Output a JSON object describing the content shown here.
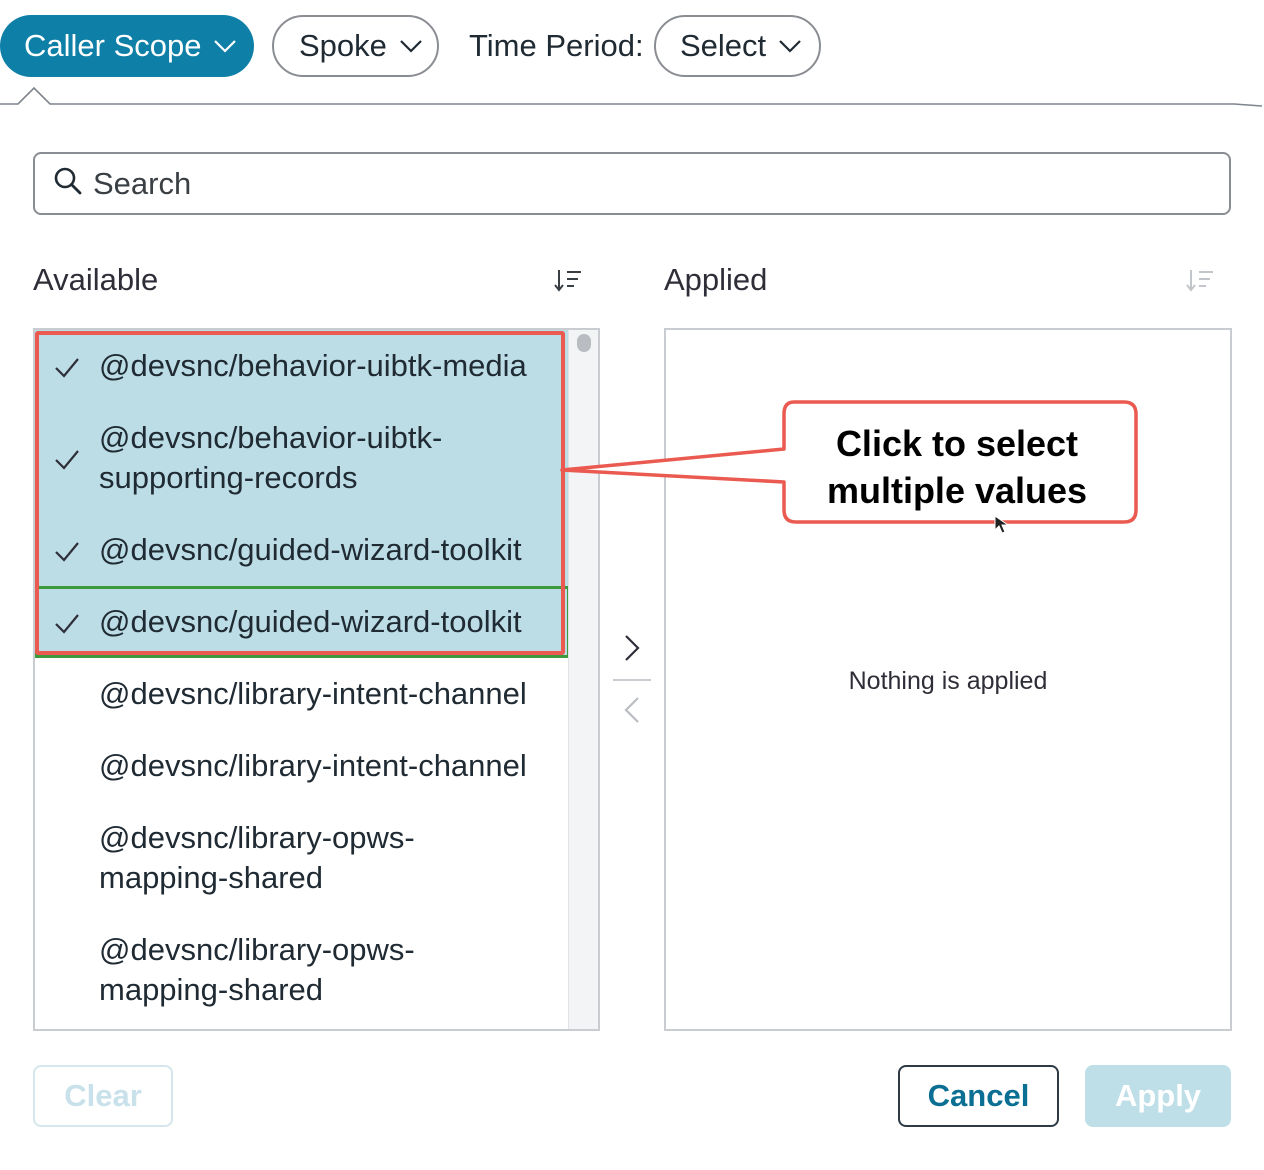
{
  "filters": {
    "caller_scope_label": "Caller Scope",
    "spoke_label": "Spoke",
    "time_period_label": "Time Period:",
    "time_period_select": "Select"
  },
  "search": {
    "placeholder": "Search"
  },
  "available": {
    "title": "Available",
    "items": [
      {
        "lines": [
          "@devsnc/behavior-uibtk-media"
        ],
        "selected": true
      },
      {
        "lines": [
          "@devsnc/behavior-uibtk-",
          "supporting-records"
        ],
        "selected": true
      },
      {
        "lines": [
          "@devsnc/guided-wizard-toolkit"
        ],
        "selected": true
      },
      {
        "lines": [
          "@devsnc/guided-wizard-toolkit"
        ],
        "selected": true,
        "focused": true
      },
      {
        "lines": [
          "@devsnc/library-intent-channel"
        ],
        "selected": false
      },
      {
        "lines": [
          "@devsnc/library-intent-channel"
        ],
        "selected": false
      },
      {
        "lines": [
          "@devsnc/library-opws-",
          "mapping-shared"
        ],
        "selected": false
      },
      {
        "lines": [
          "@devsnc/library-opws-",
          "mapping-shared"
        ],
        "selected": false
      }
    ]
  },
  "applied": {
    "title": "Applied",
    "empty_message": "Nothing is applied"
  },
  "callout": {
    "line1": "Click to select",
    "line2": "multiple values"
  },
  "footer": {
    "clear_label": "Clear",
    "cancel_label": "Cancel",
    "apply_label": "Apply"
  },
  "icons": {
    "chevron": "chevron-down-icon",
    "search": "search-icon",
    "sort": "sort-icon",
    "check": "check-icon",
    "move_right": "chevron-right-icon",
    "move_left": "chevron-left-icon"
  },
  "colors": {
    "accent": "#0e7fa6",
    "selected_row": "#bcdde6",
    "callout_border": "#ea5a50",
    "focus_border": "#3c9a3c",
    "apply_disabled": "#bfdfe8"
  }
}
